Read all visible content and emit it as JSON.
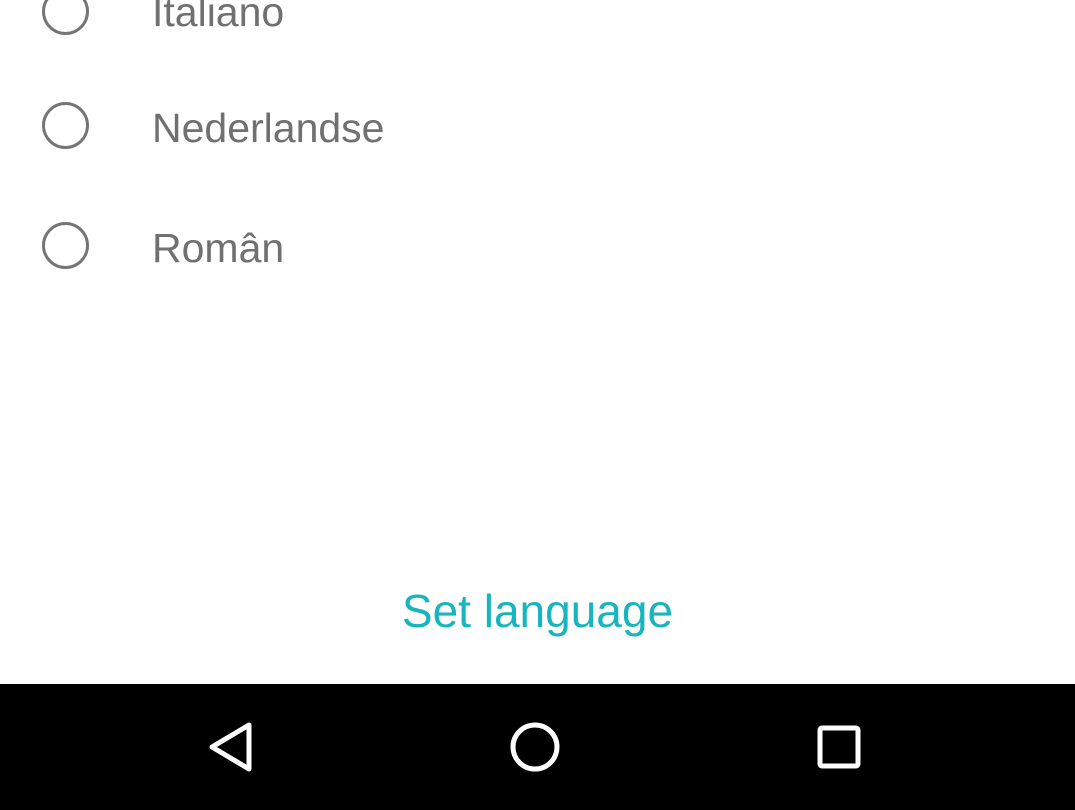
{
  "language_options": [
    {
      "label": "Italiano",
      "selected": false
    },
    {
      "label": "Nederlandse",
      "selected": false
    },
    {
      "label": "Român",
      "selected": false
    }
  ],
  "set_language_button": {
    "label": "Set language"
  },
  "colors": {
    "accent": "#17b5bd",
    "radio_unselected": "#757575",
    "option_text": "#707070",
    "nav_background": "#000000",
    "nav_icon": "#ffffff"
  },
  "navigation_bar": {
    "buttons": [
      {
        "icon": "back-triangle-icon"
      },
      {
        "icon": "home-circle-icon"
      },
      {
        "icon": "recents-square-icon"
      }
    ]
  }
}
